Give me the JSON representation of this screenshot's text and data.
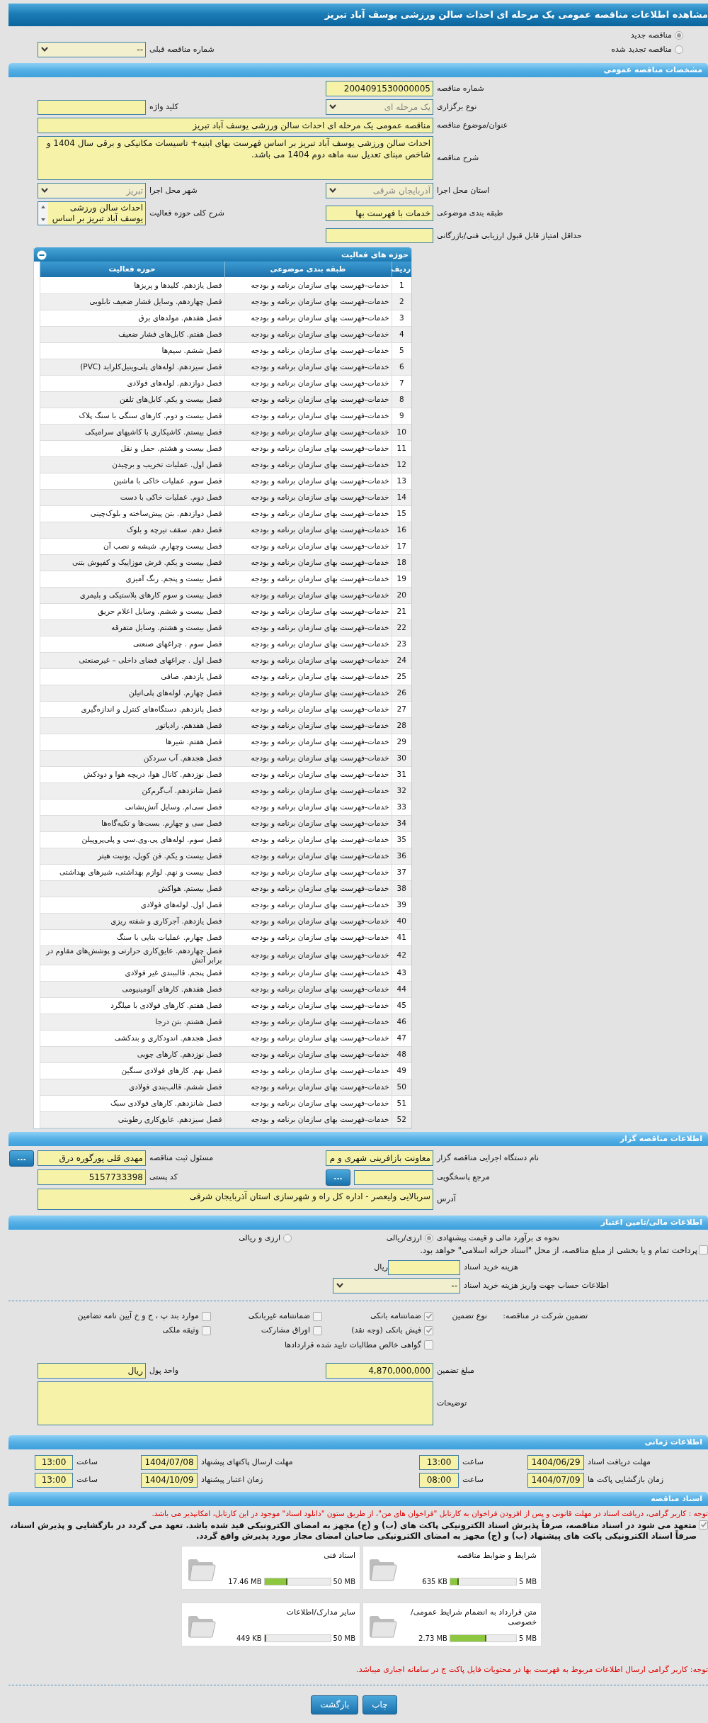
{
  "title": "مشاهده اطلاعات مناقصه عمومی یک مرحله ای احداث سالن ورزشی یوسف آباد تبریز",
  "tender_mode": [
    {
      "label": "مناقصه جدید",
      "selected": true
    },
    {
      "label": "مناقصه تجدید شده",
      "selected": false
    }
  ],
  "previous_tender": {
    "label": "شماره مناقصه قبلی",
    "kind": "select",
    "value": "--",
    "disabled": false
  },
  "general": {
    "header": "مشخصات مناقصه عمومی",
    "rows": [
      [
        {
          "label": "شماره مناقصه",
          "kind": "input",
          "value": "2004091530000005"
        }
      ],
      [
        {
          "label": "نوع برگزاری",
          "kind": "select",
          "value": "یک مرحله ای",
          "disabled": true
        },
        {
          "label": "کلید واژه",
          "kind": "input"
        }
      ],
      [
        {
          "label": "عنوان/موضوع مناقصه",
          "kind": "wide_input",
          "value": "مناقصه عمومی یک مرحله ای احداث سالن ورزشی یوسف آباد تبریز"
        }
      ],
      [
        {
          "label": "شرح مناقصه",
          "kind": "textarea",
          "value": "احداث سالن ورزشی یوسف آباد تبریز بر اساس فهرست بهای ابنیه+ تاسیسات مکانیکی و برقی سال 1404 و شاخص مبنای تعدیل سه ماهه دوم 1404 می باشد."
        }
      ],
      [
        {
          "label": "استان محل اجرا",
          "kind": "select",
          "value": "آذربایجان شرقی",
          "disabled": true
        },
        {
          "label": "شهر محل اجرا",
          "kind": "select",
          "value": "تبریز",
          "disabled": true
        }
      ],
      [
        {
          "label": "طبقه بندی موضوعی",
          "kind": "input",
          "value": "خدمات با فهرست بها"
        },
        {
          "label": "شرح کلی حوزه فعالیت",
          "kind": "scrollbox",
          "value": "احداث سالن ورزشی یوسف آباد تبریز بر اساس"
        }
      ],
      [
        {
          "label": "حداقل امتیاز قابل قبول ارزیابی فنی/بازرگانی",
          "kind": "input"
        }
      ]
    ]
  },
  "activities": {
    "header": "حوزه های فعالیت",
    "columns": [
      "ردیف",
      "طبقه بندی موضوعی",
      "حوزه فعالیت"
    ],
    "rows": [
      [
        "1",
        "خدمات-فهرست بهای سازمان برنامه و بودجه",
        "فصل یازدهم. کلیدها و پریزها"
      ],
      [
        "2",
        "خدمات-فهرست بهای سازمان برنامه و بودجه",
        "فصل چهاردهم. وسایل فشار ضعیف تابلویی"
      ],
      [
        "3",
        "خدمات-فهرست بهای سازمان برنامه و بودجه",
        "فصل هفدهم. مولدهای برق"
      ],
      [
        "4",
        "خدمات-فهرست بهای سازمان برنامه و بودجه",
        "فصل هفتم. کابل‌های فشار ضعیف"
      ],
      [
        "5",
        "خدمات-فهرست بهای سازمان برنامه و بودجه",
        "فصل ششم. سیم‌ها"
      ],
      [
        "6",
        "خدمات-فهرست بهای سازمان برنامه و بودجه",
        "فصل سیزدهم. لوله‌های پلی‌وینیل‌کلراید (PVC)"
      ],
      [
        "7",
        "خدمات-فهرست بهای سازمان برنامه و بودجه",
        "فصل دوازدهم. لوله‌های فولادی"
      ],
      [
        "8",
        "خدمات-فهرست بهای سازمان برنامه و بودجه",
        "فصل بیست و یکم. کابل‌های تلفن"
      ],
      [
        "9",
        "خدمات-فهرست بهای سازمان برنامه و بودجه",
        "فصل بیست و دوم. کارهای سنگی با سنگ پلاک"
      ],
      [
        "10",
        "خدمات-فهرست بهای سازمان برنامه و بودجه",
        "فصل بیستم. کاشیکاری با کاشیهای سرامیکی"
      ],
      [
        "11",
        "خدمات-فهرست بهای سازمان برنامه و بودجه",
        "فصل بیست و هشتم. حمل و نقل"
      ],
      [
        "12",
        "خدمات-فهرست بهای سازمان برنامه و بودجه",
        "فصل اول. عملیات تخریب و برچیدن"
      ],
      [
        "13",
        "خدمات-فهرست بهای سازمان برنامه و بودجه",
        "فصل سوم. عملیات خاکی با ماشین"
      ],
      [
        "14",
        "خدمات-فهرست بهای سازمان برنامه و بودجه",
        "فصل دوم. عملیات خاکی با دست"
      ],
      [
        "15",
        "خدمات-فهرست بهای سازمان برنامه و بودجه",
        "فصل دوازدهم. بتن پیش‌ساخته و بلوک‌چینی"
      ],
      [
        "16",
        "خدمات-فهرست بهای سازمان برنامه و بودجه",
        "فصل دهم. سقف تیرچه و بلوک"
      ],
      [
        "17",
        "خدمات-فهرست بهای سازمان برنامه و بودجه",
        "فصل بیست وچهارم. شیشه و نصب آن"
      ],
      [
        "18",
        "خدمات-فهرست بهای سازمان برنامه و بودجه",
        "فصل بیست و یکم. فرش موزاییک و کفپوش بتنی"
      ],
      [
        "19",
        "خدمات-فهرست بهای سازمان برنامه و بودجه",
        "فصل بیست و پنجم. رنگ آمیزی"
      ],
      [
        "20",
        "خدمات-فهرست بهای سازمان برنامه و بودجه",
        "فصل بیست و سوم کارهای پلاستیکی و پلیمری"
      ],
      [
        "21",
        "خدمات-فهرست بهای سازمان برنامه و بودجه",
        "فصل بیست و ششم. وسایل اعلام حریق"
      ],
      [
        "22",
        "خدمات-فهرست بهای سازمان برنامه و بودجه",
        "فصل بیست و هشتم. وسایل متفرقه"
      ],
      [
        "23",
        "خدمات-فهرست بهای سازمان برنامه و بودجه",
        "فصل سوم . چراغهای صنعتی"
      ],
      [
        "24",
        "خدمات-فهرست بهای سازمان برنامه و بودجه",
        "فصل اول . چراغهای فضای داخلی – غیرصنعتی"
      ],
      [
        "25",
        "خدمات-فهرست بهای سازمان برنامه و بودجه",
        "فصل یازدهم. صافی"
      ],
      [
        "26",
        "خدمات-فهرست بهای سازمان برنامه و بودجه",
        "فصل چهارم. لوله‌های پلی‌اتیلن"
      ],
      [
        "27",
        "خدمات-فهرست بهای سازمان برنامه و بودجه",
        "فصل پانزدهم. دستگاه‌های کنترل و اندازه‌گیری"
      ],
      [
        "28",
        "خدمات-فهرست بهای سازمان برنامه و بودجه",
        "فصل هفدهم. رادیاتور"
      ],
      [
        "29",
        "خدمات-فهرست بهای سازمان برنامه و بودجه",
        "فصل هفتم. شیرها"
      ],
      [
        "30",
        "خدمات-فهرست بهای سازمان برنامه و بودجه",
        "فصل هجدهم. آب سردکن"
      ],
      [
        "31",
        "خدمات-فهرست بهای سازمان برنامه و بودجه",
        "فصل نوزدهم. کانال هوا، دریچه هوا و دودکش"
      ],
      [
        "32",
        "خدمات-فهرست بهای سازمان برنامه و بودجه",
        "فصل شانزدهم. آب‌گرم‌کن"
      ],
      [
        "33",
        "خدمات-فهرست بهای سازمان برنامه و بودجه",
        "فصل سی‌ام. وسایل آتش‌نشانی"
      ],
      [
        "34",
        "خدمات-فهرست بهای سازمان برنامه و بودجه",
        "فصل سی و چهارم. بست‌ها و تکیه‌گاه‌ها"
      ],
      [
        "35",
        "خدمات-فهرست بهای سازمان برنامه و بودجه",
        "فصل سوم. لوله‌های پی.وی.سی و پلی‌پروپیلن"
      ],
      [
        "36",
        "خدمات-فهرست بهای سازمان برنامه و بودجه",
        "فصل بیست و یکم. فن کویل، یونیت هیتر"
      ],
      [
        "37",
        "خدمات-فهرست بهای سازمان برنامه و بودجه",
        "فصل بیست و نهم. لوازم بهداشتی، شیرهای بهداشتی"
      ],
      [
        "38",
        "خدمات-فهرست بهای سازمان برنامه و بودجه",
        "فصل بیستم. هواکش"
      ],
      [
        "39",
        "خدمات-فهرست بهای سازمان برنامه و بودجه",
        "فصل اول. لوله‌های فولادی"
      ],
      [
        "40",
        "خدمات-فهرست بهای سازمان برنامه و بودجه",
        "فصل یازدهم. آجرکاری و شفته ریزی"
      ],
      [
        "41",
        "خدمات-فهرست بهای سازمان برنامه و بودجه",
        "فصل چهارم. عملیات بنایی با سنگ"
      ],
      [
        "42",
        "خدمات-فهرست بهای سازمان برنامه و بودجه",
        "فصل چهاردهم. عایق‌کاری حرارتی و پوشش‌های مقاوم در برابر آتش"
      ],
      [
        "43",
        "خدمات-فهرست بهای سازمان برنامه و بودجه",
        "فصل پنجم. قالببندی غیر فولادی"
      ],
      [
        "44",
        "خدمات-فهرست بهای سازمان برنامه و بودجه",
        "فصل هفدهم. کارهای آلومینیومی"
      ],
      [
        "45",
        "خدمات-فهرست بهای سازمان برنامه و بودجه",
        "فصل هفتم. کارهای فولادی با میلگرد"
      ],
      [
        "46",
        "خدمات-فهرست بهای سازمان برنامه و بودجه",
        "فصل هشتم. بتن درجا"
      ],
      [
        "47",
        "خدمات-فهرست بهای سازمان برنامه و بودجه",
        "فصل هجدهم. اندودکاری و بندکشی"
      ],
      [
        "48",
        "خدمات-فهرست بهای سازمان برنامه و بودجه",
        "فصل نوزدهم. کارهای چوبی"
      ],
      [
        "49",
        "خدمات-فهرست بهای سازمان برنامه و بودجه",
        "فصل نهم. کارهای فولادی سنگین"
      ],
      [
        "50",
        "خدمات-فهرست بهای سازمان برنامه و بودجه",
        "فصل ششم. قالب‌بندی فولادی"
      ],
      [
        "51",
        "خدمات-فهرست بهای سازمان برنامه و بودجه",
        "فصل شانزدهم. کارهای فولادی سبک"
      ],
      [
        "52",
        "خدمات-فهرست بهای سازمان برنامه و بودجه",
        "فصل سیزدهم. عایق‌کاری رطوبتی"
      ]
    ]
  },
  "contractor": {
    "header": "اطلاعات مناقصه گزار",
    "rows": [
      [
        {
          "label": "نام دستگاه اجرایی مناقصه گزار",
          "kind": "input",
          "value": "معاونت بازافرینی شهری و م"
        },
        {
          "label": "مسئول ثبت مناقصه",
          "kind": "input",
          "value": "مهدی قلی پورگوره درق",
          "button": "..."
        }
      ],
      [
        {
          "label": "مرجع پاسخگویی",
          "kind": "input",
          "button": "..."
        },
        {
          "label": "کد پستی",
          "kind": "input",
          "value": "5157733398"
        }
      ],
      [
        {
          "label": "آدرس",
          "kind": "textarea_short",
          "value": "سربالایی ولیعصر - اداره کل راه و شهرسازی استان آذربایجان شرقی"
        }
      ]
    ]
  },
  "finance": {
    "header": "اطلاعات مالی/تامین اعتبار",
    "estimate": {
      "label": "نحوه ی برآورد مالی و قیمت پیشنهادی",
      "options": [
        {
          "label": "ارزی/ریالی",
          "selected": true
        },
        {
          "label": "ارزی و ریالی",
          "selected": false
        }
      ]
    },
    "treasury": {
      "label": "پرداخت تمام و یا بخشی از مبلغ مناقصه، از محل \"اسناد خزانه اسلامی\" خواهد بود.",
      "checked": false
    },
    "doc_cost": {
      "label": "هزینه خرید اسناد",
      "unit": "ریال"
    },
    "account": {
      "label": "اطلاعات حساب جهت واریز هزینه خرید اسناد",
      "kind": "select",
      "value": "--",
      "disabled": false
    }
  },
  "guarantee": {
    "label": "تضمین شرکت در مناقصه:",
    "type_label": "نوع تضمین",
    "options": [
      {
        "label": "ضمانتنامه بانکی",
        "checked": true
      },
      {
        "label": "ضمانتنامه غیربانکی",
        "checked": false
      },
      {
        "label": "موارد بند پ ، ج و خ آیین نامه تضامین",
        "checked": false
      },
      {
        "label": "فیش بانکی (وجه نقد)",
        "checked": true
      },
      {
        "label": "اوراق مشارکت",
        "checked": false
      },
      {
        "label": "وثیقه ملکی",
        "checked": false
      },
      {
        "label": "گواهی خالص مطالبات تایید شده قراردادها",
        "checked": false
      }
    ],
    "rows": [
      [
        {
          "label": "مبلغ تضمین",
          "kind": "input",
          "value": "4,870,000,000"
        },
        {
          "label": "واحد پول",
          "kind": "input",
          "value": "ریال"
        }
      ],
      [
        {
          "label": "توضیحات",
          "kind": "textarea"
        }
      ]
    ]
  },
  "schedule": {
    "header": "اطلاعات زمانی",
    "rows": [
      [
        {
          "label": "مهلت دریافت اسناد",
          "value": "1404/06/29"
        },
        {
          "label": "ساعت",
          "value": "13:00"
        },
        {
          "label": "مهلت ارسال پاکتهای پیشنهاد",
          "value": "1404/07/08"
        },
        {
          "label": "ساعت",
          "value": "13:00"
        }
      ],
      [
        {
          "label": "زمان بازگشایی پاکت ها",
          "value": "1404/07/09"
        },
        {
          "label": "ساعت",
          "value": "08:00"
        },
        {
          "label": "زمان اعتبار پیشنهاد",
          "value": "1404/10/09"
        },
        {
          "label": "ساعت",
          "value": "13:00"
        }
      ]
    ]
  },
  "documents": {
    "header": "اسناد مناقصه",
    "notice": "توجه : کاربر گرامی، دریافت اسناد در مهلت قانونی و پس از افزودن فراخوان به کارتابل \"فراخوان های من\"، از طریق ستون \"دانلود اسناد\" موجود در این کارتابل، امکانپذیر می باشد.",
    "commitment": {
      "text": "متعهد می شود در اسناد مناقصه، صرفاً پذیرش اسناد الکترونیکی پاکت های (ب) و (ج) مجهز به امضای الکترونیکی قید شده باشد. تعهد می گردد در بازگشایی و پذیرش اسناد، صرفاً اسناد الکترونیکی پاکت های پیشنهاد (ب) و (ج) مجهز به امضای الکترونیکی صاحبان امضای مجاز مورد پذیرش واقع گردد.",
      "checked": true
    },
    "files": [
      {
        "name": "شرایط و ضوابط مناقصه",
        "size": "635 KB",
        "max": "5 MB",
        "level": 0.124
      },
      {
        "name": "اسناد فنی",
        "size": "17.46 MB",
        "max": "50 MB",
        "level": 0.35
      },
      {
        "name": "متن قرارداد به انضمام شرایط عمومی/خصوصی",
        "size": "2.73 MB",
        "max": "5 MB",
        "level": 0.546
      },
      {
        "name": "سایر مدارک/اطلاعات",
        "size": "449 KB",
        "max": "50 MB",
        "level": 0.01
      }
    ]
  },
  "footer_note": "توجه: کاربر گرامی ارسال اطلاعات مربوط به فهرست بها در محتویات فایل پاکت ج در سامانه اجباری میباشد.",
  "buttons": [
    "چاپ",
    "بازگشت"
  ]
}
